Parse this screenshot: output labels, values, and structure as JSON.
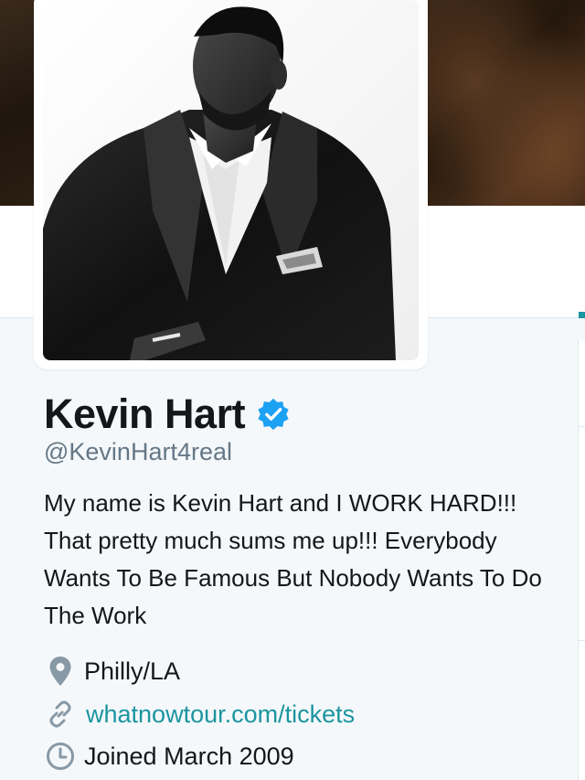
{
  "profile": {
    "name": "Kevin Hart",
    "handle": "@KevinHart4real",
    "verified": true,
    "bio": "My name is Kevin Hart and I WORK HARD!!! That pretty much sums me up!!! Everybody Wants To Be Famous But Nobody Wants To Do The Work",
    "location": "Philly/LA",
    "website": "whatnowtour.com/tickets",
    "joined": "Joined March 2009"
  },
  "icons": {
    "verified": "verified-badge-icon",
    "location": "map-pin-icon",
    "website": "link-icon",
    "joined": "clock-icon"
  },
  "colors": {
    "link": "#1b95a0",
    "verified": "#1da1f2",
    "secondary_text": "#657786",
    "profile_background": "#f5f8fa"
  }
}
